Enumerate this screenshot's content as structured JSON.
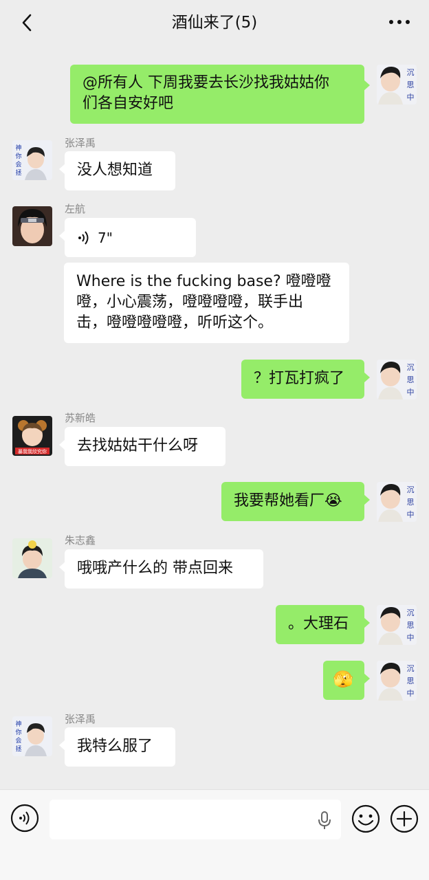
{
  "header": {
    "title": "酒仙来了(5)"
  },
  "messages": [
    {
      "side": "me",
      "text_lines": [
        "@所有人 下周我要去长沙找我姑姑你",
        "们各自安好吧"
      ]
    },
    {
      "side": "other",
      "sender": "张泽禹",
      "text": "没人想知道"
    },
    {
      "side": "other",
      "sender": "左航",
      "voice_duration": "7\""
    },
    {
      "side": "other",
      "text_lines": [
        "Where is the fucking base? 噔噔噔",
        "噔，小心震荡，噔噔噔噔，联手出",
        "击，噔噔噔噔噔，听听这个。"
      ]
    },
    {
      "side": "me",
      "text": "？打瓦打疯了"
    },
    {
      "side": "other",
      "sender": "苏新皓",
      "text": "去找姑姑干什么呀"
    },
    {
      "side": "me",
      "text": "我要帮她看厂",
      "emoji": "😭"
    },
    {
      "side": "other",
      "sender": "朱志鑫",
      "text": "哦哦产什么的 带点回来"
    },
    {
      "side": "me",
      "text": "。大理石"
    },
    {
      "side": "me",
      "emoji": "🫣"
    },
    {
      "side": "other",
      "sender": "张泽禹",
      "text": "我特么服了"
    }
  ],
  "avatars": {
    "me_caption": "沉思中",
    "zhangzeyu_caption": "神你会拯救我吗",
    "suxinhao_caption": "暴我我欣究你"
  },
  "colors": {
    "my_bubble": "#95ec69",
    "other_bubble": "#ffffff",
    "background": "#ededed"
  },
  "icons": {
    "back": "chevron-left-icon",
    "more": "more-dots-icon",
    "voice": "voice-wave-icon",
    "mic": "microphone-icon",
    "emoji": "smiley-icon",
    "plus": "plus-circle-icon"
  }
}
